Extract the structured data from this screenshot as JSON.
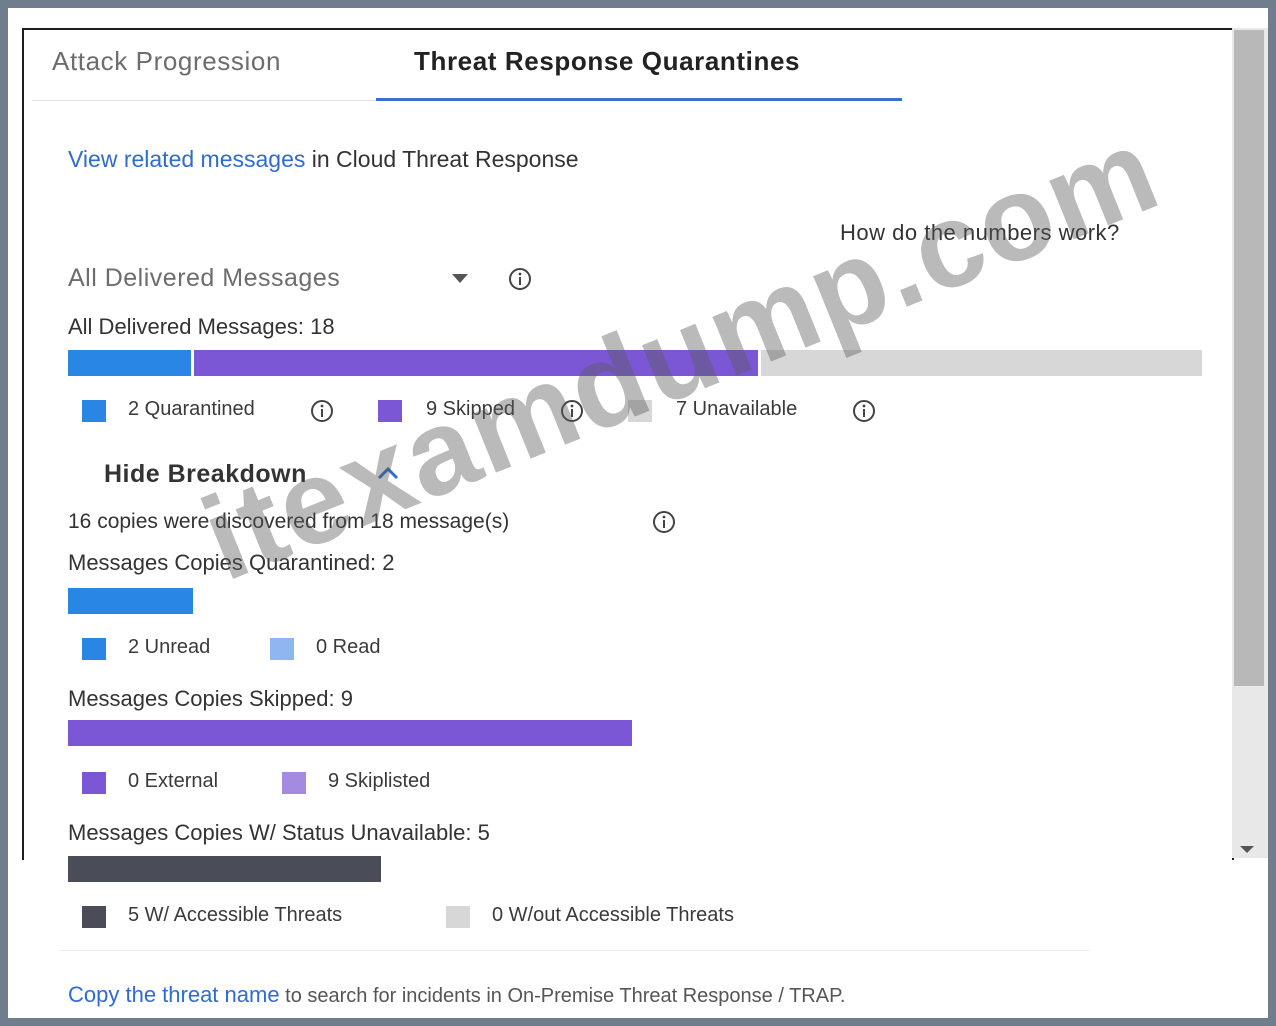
{
  "tabs": [
    {
      "label": "Attack Progression",
      "active": false
    },
    {
      "label": "Threat Response Quarantines",
      "active": true
    }
  ],
  "related": {
    "link": "View related messages",
    "suffix": " in Cloud Threat Response"
  },
  "help_link": "How do the numbers work?",
  "filter": {
    "selected": "All Delivered Messages"
  },
  "summary": {
    "title": "All Delivered Messages: 18",
    "total": 18,
    "segments": [
      {
        "label": "2 Quarantined",
        "value": 2,
        "color": "#2a86e4"
      },
      {
        "label": "9 Skipped",
        "value": 9,
        "color": "#7b57d6"
      },
      {
        "label": "7 Unavailable",
        "value": 7,
        "color": "#d7d7d7"
      }
    ]
  },
  "breakdown": {
    "toggle_label": "Hide Breakdown",
    "note": "16 copies were discovered from 18 message(s)",
    "quarantined": {
      "title": "Messages Copies Quarantined: 2",
      "value": 2,
      "legend": [
        {
          "label": "2 Unread",
          "color": "#2a86e4"
        },
        {
          "label": "0 Read",
          "color": "#8fb6f0"
        }
      ]
    },
    "skipped": {
      "title": "Messages Copies Skipped: 9",
      "value": 9,
      "legend": [
        {
          "label": "0 External",
          "color": "#7b57d6"
        },
        {
          "label": "9 Skiplisted",
          "color": "#a58be0"
        }
      ]
    },
    "unavailable": {
      "title": "Messages Copies W/ Status Unavailable: 5",
      "value": 5,
      "legend": [
        {
          "label": "5 W/ Accessible Threats",
          "color": "#4a4d57"
        },
        {
          "label": "0 W/out Accessible Threats",
          "color": "#d7d7d7"
        }
      ]
    }
  },
  "footer": {
    "link": "Copy the threat name",
    "suffix": " to search for incidents in On-Premise Threat Response / TRAP."
  },
  "watermark": "itexamdump.com"
}
